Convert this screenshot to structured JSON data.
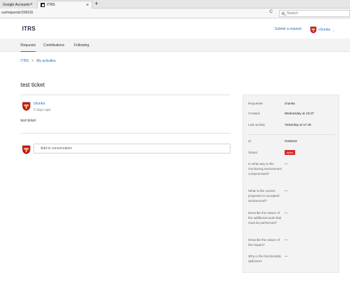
{
  "browser": {
    "tabs": [
      {
        "label": "Google Accounts",
        "active": false
      },
      {
        "label": "ITRS",
        "active": true
      }
    ],
    "url": "-us/requests/156016",
    "search_placeholder": "Search"
  },
  "header": {
    "logo": "ITRS",
    "submit_label": "Submit a request",
    "user_name": "chunka",
    "user_chevron": "⌄"
  },
  "nav": {
    "items": [
      "Requests",
      "Contributions",
      "Following"
    ],
    "active": "Requests"
  },
  "breadcrumb": {
    "items": [
      "ITRS",
      "My activities"
    ],
    "separator": ">"
  },
  "ticket": {
    "title": "test ticket",
    "author": "chunka",
    "time": "2 days ago",
    "body": "test ticket",
    "reply_placeholder": "Add to conversation"
  },
  "sidebar": {
    "requester_label": "Requester",
    "requester_value": "chunka",
    "created_label": "Created",
    "created_value": "Wednesday at 15:37",
    "last_activity_label": "Last activity",
    "last_activity_value": "Yesterday at 17:45",
    "id_label": "Id",
    "id_value": "#156016",
    "status_label": "Status",
    "status_value": "open",
    "status_color": "#d62b2b",
    "fields": [
      {
        "label": "In what way is the monitoring environment compromised?",
        "value": "—"
      },
      {
        "label": "What is the current proposed or accepted workaround?",
        "value": "—"
      },
      {
        "label": "Describe the nature of the additional work that must be performed?",
        "value": "—"
      },
      {
        "label": "Describe the nature of the impact?",
        "value": "—"
      },
      {
        "label": "Why is the functionality deficient?",
        "value": "—"
      }
    ]
  },
  "colors": {
    "link": "#1e73be",
    "status": "#d62b2b"
  }
}
